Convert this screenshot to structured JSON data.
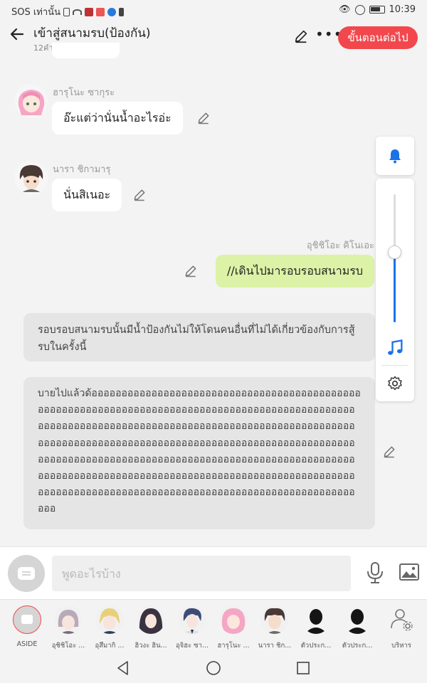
{
  "status_bar": {
    "left_text": "SOS เท่านั้น",
    "time": "10:39"
  },
  "header": {
    "title": "เข้าสู่สนามรบ(ป้องกัน)",
    "subtitle": "12คำ",
    "next_button": "ขั้นตอนต่อไป"
  },
  "messages": [
    {
      "speaker": "ฮารุโนะ ซากุระ",
      "text": "อ๊ะแต่ว่านั่นน้ำอะไรอ่ะ",
      "side": "left",
      "avatar_color": "#f4a6c4"
    },
    {
      "speaker": "นารา ชิกามารุ",
      "text": "นั่นสิเนอะ",
      "side": "left",
      "avatar_color": "#6b5a55"
    },
    {
      "speaker": "อุชิชิโอะ คิโนเอะ",
      "text": "//เดินไปมารอบรอบสนามรบ",
      "side": "right"
    }
  ],
  "narrations": [
    "รอบรอบสนามรบนั้นมีน้ำป้องกันไม่ให้โดนคนอื่นที่ไม่ได้เกี่ยวข้องกับการสู้รบในครั้งนี้",
    "บายไปแล้วด้ออออออออออออออออออออออออออออออออออออออออออออออออออออออออออออออออออออออออออออออออออออออออออออออออออออออออออออออออออออออออออออออออออออออออออออออออออออออออออออออออออออออออออออออออออออออออออออออออออออออออออออออออออออออออออออออออออออออออออออออออออออออออออออออออออออออออออออออออออออออออออออออออออออออออออออออออออออออออออออออออออออออออออออออออออออออออออออออออออออออออออออออ"
  ],
  "side_panel": {
    "volume_fraction": 0.55,
    "accent": "#1a73e8"
  },
  "input": {
    "placeholder": "พูดอะไรบ้าง"
  },
  "characters": [
    {
      "label": "ASIDE",
      "color": "#d5d5d5",
      "selected": true
    },
    {
      "label": "อุชิชิโอะ ...",
      "color": "#b9aab9"
    },
    {
      "label": "อุสึมากิ ...",
      "color": "#e8cf7a"
    },
    {
      "label": "ฮิวงะ ฮิน...",
      "color": "#3b3240"
    },
    {
      "label": "อุจิฮะ ซา...",
      "color": "#3c4c78"
    },
    {
      "label": "ฮารุโนะ ...",
      "color": "#f4a6c4"
    },
    {
      "label": "นารา ชิก...",
      "color": "#6b5a55"
    },
    {
      "label": "ตัวประก...",
      "color": "#151515"
    },
    {
      "label": "ตัวประก...",
      "color": "#151515"
    },
    {
      "label": "บริหาร",
      "color": "#ffffff"
    }
  ],
  "colors": {
    "accent_red": "#f2484d",
    "bubble_green": "#dcf2a6"
  }
}
